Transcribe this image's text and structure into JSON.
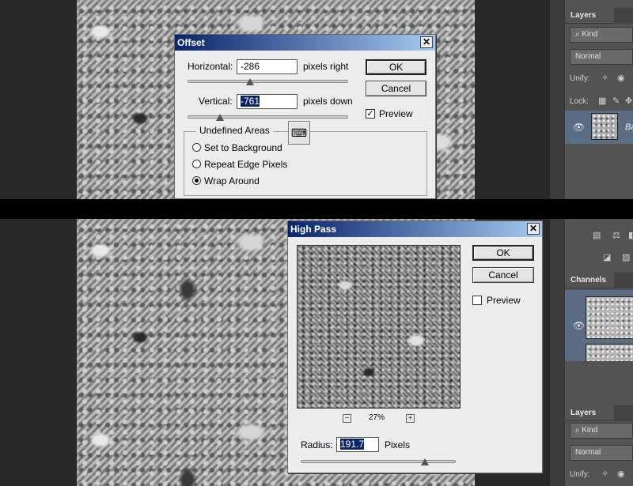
{
  "offset_dialog": {
    "title": "Offset",
    "close_glyph": "✕",
    "horizontal_label": "Horizontal:",
    "horizontal_value": "-286",
    "horizontal_unit": "pixels right",
    "vertical_label": "Vertical:",
    "vertical_value": "-761",
    "vertical_unit": "pixels down",
    "ok_label": "OK",
    "cancel_label": "Cancel",
    "preview_label": "Preview",
    "preview_checked": true,
    "check_glyph": "✓",
    "undefined_areas_label": "Undefined Areas",
    "keyboard_glyph": "⌨",
    "options": [
      "Set to Background",
      "Repeat Edge Pixels",
      "Wrap Around"
    ],
    "selected_option": "Wrap Around"
  },
  "high_pass_dialog": {
    "title": "High Pass",
    "close_glyph": "✕",
    "ok_label": "OK",
    "cancel_label": "Cancel",
    "preview_label": "Preview",
    "preview_checked": false,
    "zoom_level": "27%",
    "zoom_out_glyph": "−",
    "zoom_in_glyph": "+",
    "radius_label": "Radius:",
    "radius_value": "191.7",
    "radius_unit": "Pixels"
  },
  "layers_panel_top": {
    "tab_label": "Layers",
    "kind_label": "Kind",
    "search_glyph": "⌕",
    "blend_mode": "Normal",
    "unify_label": "Unify:",
    "lock_label": "Lock:",
    "eye_glyph": "👁",
    "layer_name": "Ba"
  },
  "channels_panel": {
    "tab_label": "Channels",
    "eye_glyph": "👁"
  },
  "layers_panel_bottom": {
    "tab_label": "Layers",
    "kind_label": "Kind",
    "search_glyph": "⌕",
    "blend_mode": "Normal",
    "unify_label": "Unify:"
  },
  "colors": {
    "titlebar_start": "#0a246a",
    "titlebar_end": "#a6caf0",
    "dialog_bg": "#ececec",
    "selection_bg": "#0a246a",
    "panel_bg": "#535353",
    "selected_row": "#5b6c85"
  }
}
